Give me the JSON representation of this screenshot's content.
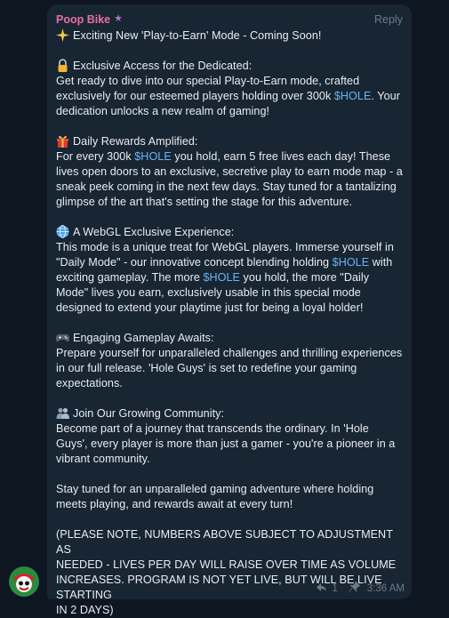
{
  "message": {
    "sender": "Poop Bike",
    "reply_label": "Reply",
    "sections": [
      {
        "icon": "sparkle-icon",
        "lines": [
          [
            "Exciting New 'Play-to-Earn' Mode - Coming Soon!"
          ]
        ]
      },
      {
        "icon": "lock-icon",
        "lines": [
          [
            "Exclusive Access for the Dedicated:"
          ],
          [
            "Get ready to dive into our special Play-to-Earn mode, crafted"
          ],
          [
            "exclusively for our esteemed players holding over 300k ",
            "$HOLE",
            ". Your"
          ],
          [
            "dedication unlocks a new realm of gaming!"
          ]
        ]
      },
      {
        "icon": "gift-icon",
        "lines": [
          [
            "Daily Rewards Amplified:"
          ],
          [
            "For every 300k ",
            "$HOLE",
            " you hold, earn 5 free lives each day! These"
          ],
          [
            "lives open doors to an exclusive, secretive play to earn mode map - a"
          ],
          [
            "sneak peek coming in the next few days. Stay tuned for a tantalizing"
          ],
          [
            "glimpse of the art that's setting the stage for this adventure."
          ]
        ]
      },
      {
        "icon": "globe-icon",
        "lines": [
          [
            "A WebGL Exclusive Experience:"
          ],
          [
            "This mode is a unique treat for WebGL players. Immerse yourself in"
          ],
          [
            "\"Daily Mode\" - our innovative concept blending holding ",
            "$HOLE",
            " with"
          ],
          [
            "exciting gameplay. The more ",
            "$HOLE",
            " you hold, the more \"Daily"
          ],
          [
            "Mode\" lives you earn, exclusively usable in this special mode"
          ],
          [
            "designed to extend your playtime just for being a loyal holder!"
          ]
        ]
      },
      {
        "icon": "gamepad-icon",
        "lines": [
          [
            "Engaging Gameplay Awaits:"
          ],
          [
            "Prepare yourself for unparalleled challenges and thrilling experiences"
          ],
          [
            "in our full release. 'Hole Guys' is set to redefine your gaming"
          ],
          [
            "expectations."
          ]
        ]
      },
      {
        "icon": "people-icon",
        "lines": [
          [
            "Join Our Growing Community:"
          ],
          [
            "Become part of a journey that transcends the ordinary. In 'Hole"
          ],
          [
            "Guys', every player is more than just a gamer - you're a pioneer in a"
          ],
          [
            "vibrant community."
          ]
        ]
      },
      {
        "icon": null,
        "lines": [
          [
            "Stay tuned for an unparalleled gaming adventure where holding"
          ],
          [
            "meets playing, and rewards await at every turn!"
          ]
        ]
      },
      {
        "icon": null,
        "lines": [
          [
            "(PLEASE NOTE, NUMBERS ABOVE SUBJECT TO ADJUSTMENT AS"
          ],
          [
            "NEEDED - LIVES PER DAY WILL RAISE OVER TIME AS VOLUME"
          ],
          [
            "INCREASES.  PROGRAM IS NOT YET LIVE, BUT WILL BE LIVE STARTING"
          ],
          [
            "IN 2 DAYS)"
          ]
        ]
      }
    ],
    "reply_count": "1",
    "time": "3:36 AM"
  },
  "colors": {
    "accent": "#6ab3f3",
    "sender": "#e86fa6",
    "bubble": "#182533",
    "background": "#0e1621"
  }
}
